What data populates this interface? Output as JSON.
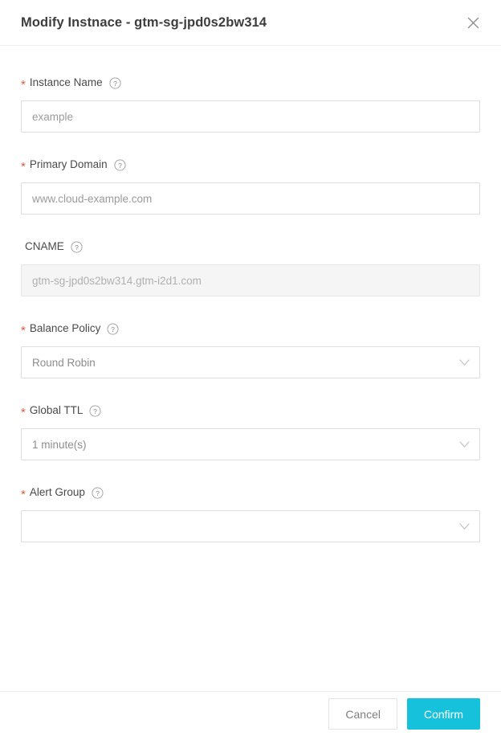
{
  "dialog": {
    "title": "Modify Instnace - gtm-sg-jpd0s2bw314",
    "close_icon": "close-icon"
  },
  "colors": {
    "required_star": "#e4573d",
    "confirm_button": "#16c2db",
    "border": "#e0e0e0",
    "disabled_background": "#f5f5f5"
  },
  "form": {
    "fields": [
      {
        "id": "instance-name",
        "label": "Instance Name",
        "required": true,
        "required_marker": "*",
        "help_icon": "question-circle-icon",
        "control": "text",
        "value": "example",
        "placeholder": "example",
        "disabled": false
      },
      {
        "id": "primary-domain",
        "label": "Primary Domain",
        "required": true,
        "required_marker": "*",
        "help_icon": "question-circle-icon",
        "control": "text",
        "value": "www.cloud-example.com",
        "placeholder": "www.cloud-example.com",
        "disabled": false
      },
      {
        "id": "cname",
        "label": "CNAME",
        "required": false,
        "required_marker": "",
        "help_icon": "question-circle-icon",
        "control": "text",
        "value": "gtm-sg-jpd0s2bw314.gtm-i2d1.com",
        "placeholder": "gtm-sg-jpd0s2bw314.gtm-i2d1.com",
        "disabled": true
      },
      {
        "id": "balance-policy",
        "label": "Balance Policy",
        "required": true,
        "required_marker": "*",
        "help_icon": "question-circle-icon",
        "control": "select",
        "value": "Round Robin",
        "chevron_icon": "chevron-down-icon",
        "disabled": false
      },
      {
        "id": "global-ttl",
        "label": "Global TTL",
        "required": true,
        "required_marker": "*",
        "help_icon": "question-circle-icon",
        "control": "select",
        "value": "1 minute(s)",
        "chevron_icon": "chevron-down-icon",
        "disabled": false
      },
      {
        "id": "alert-group",
        "label": "Alert Group",
        "required": true,
        "required_marker": "*",
        "help_icon": "question-circle-icon",
        "control": "select",
        "value": "",
        "chevron_icon": "chevron-down-icon",
        "disabled": false
      }
    ]
  },
  "footer": {
    "cancel_label": "Cancel",
    "confirm_label": "Confirm"
  }
}
